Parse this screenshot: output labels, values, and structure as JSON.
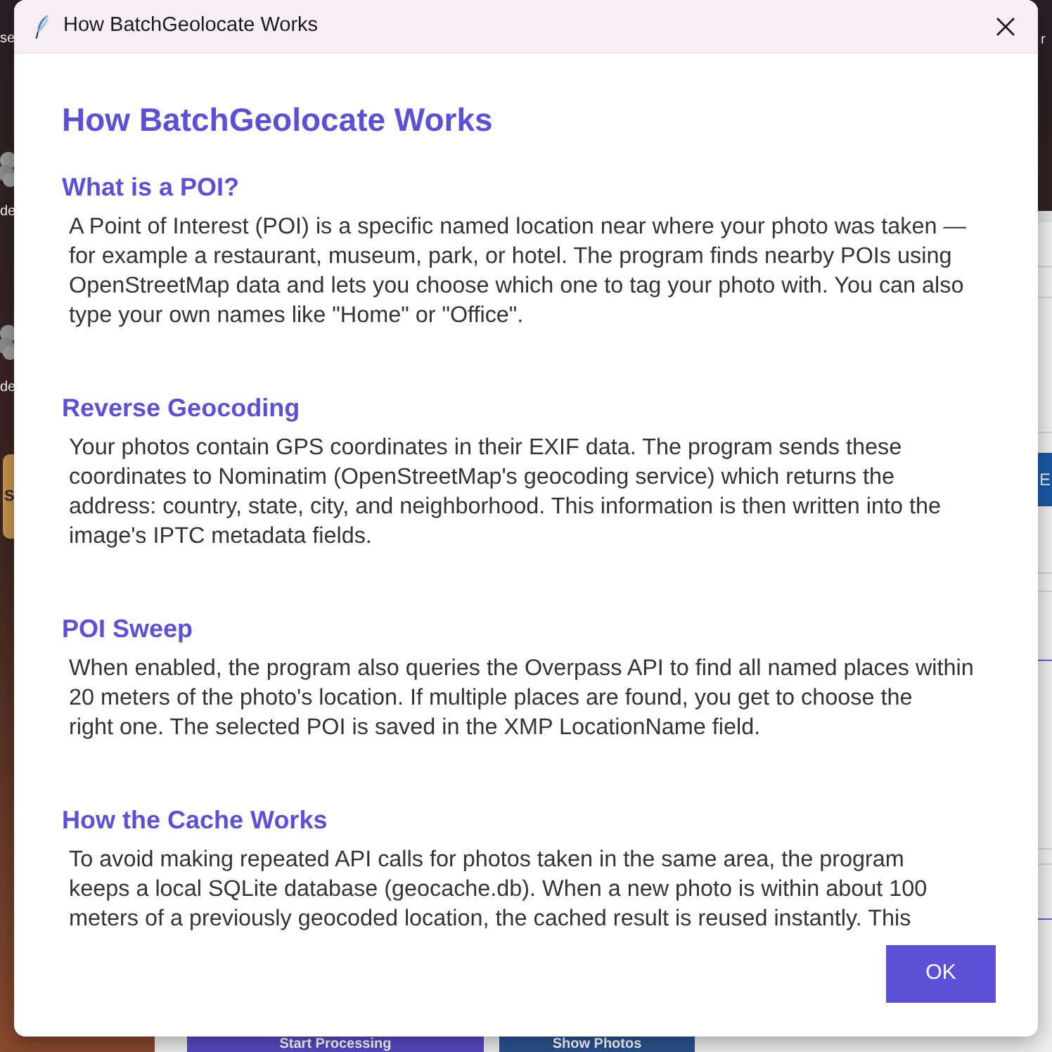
{
  "desktop": {
    "icon_labels": [
      "se",
      "de",
      "de"
    ],
    "tile_label": "S",
    "right_label": "r"
  },
  "background_app": {
    "side_button": "E",
    "buttons": [
      {
        "label": "Start Processing",
        "kind": "primary"
      },
      {
        "label": "Show Photos",
        "kind": "secondary"
      }
    ]
  },
  "dialog": {
    "title": "How BatchGeolocate Works",
    "heading": "How BatchGeolocate Works",
    "sections": [
      {
        "heading": "What is a POI?",
        "text": "A Point of Interest (POI) is a specific named location near where your photo was taken —\nfor example a restaurant, museum, park, or hotel. The program finds nearby POIs using\nOpenStreetMap data and lets you choose which one to tag your photo with. You can also\ntype your own names like \"Home\" or \"Office\"."
      },
      {
        "heading": "Reverse Geocoding",
        "text": "Your photos contain GPS coordinates in their EXIF data. The program sends these\ncoordinates to Nominatim (OpenStreetMap's geocoding service) which returns the\naddress: country, state, city, and neighborhood. This information is then written into the\nimage's IPTC metadata fields."
      },
      {
        "heading": "POI Sweep",
        "text": "When enabled, the program also queries the Overpass API to find all named places within\n20 meters of the photo's location. If multiple places are found, you get to choose the\nright one. The selected POI is saved in the XMP LocationName field."
      },
      {
        "heading": "How the Cache Works",
        "text": "To avoid making repeated API calls for photos taken in the same area, the program\nkeeps a local SQLite database (geocache.db). When a new photo is within about 100\nmeters of a previously geocoded location, the cached result is reused instantly. This"
      }
    ],
    "buttons": [
      {
        "label": "OK"
      }
    ]
  }
}
